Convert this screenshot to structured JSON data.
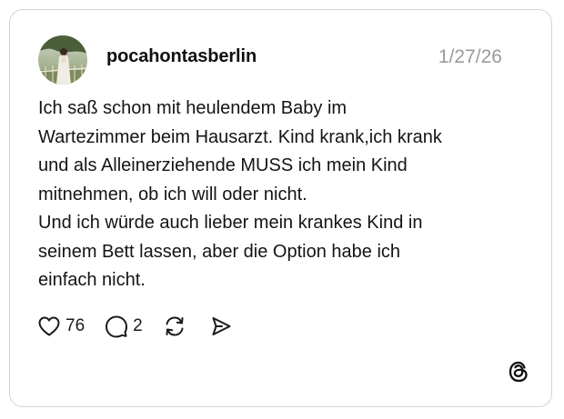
{
  "post": {
    "username": "pocahontasberlin",
    "timestamp": "1/27/26",
    "text_lines": [
      "Ich saß schon mit heulendem Baby im",
      "Wartezimmer beim Hausarzt. Kind krank,ich krank",
      "und als Alleinerziehende MUSS ich mein Kind",
      "mitnehmen, ob ich will oder nicht.",
      "Und ich würde auch lieber mein krankes Kind in",
      "seinem Bett lassen, aber die Option habe ich",
      "einfach nicht."
    ],
    "likes": "76",
    "replies": "2"
  },
  "icons": {
    "like": "heart-icon",
    "reply": "comment-icon",
    "repost": "repost-icon",
    "share": "send-icon",
    "brand": "threads-logo-icon"
  },
  "colors": {
    "text": "#101010",
    "muted": "#9a9a9a",
    "border": "#d4d4d4"
  }
}
